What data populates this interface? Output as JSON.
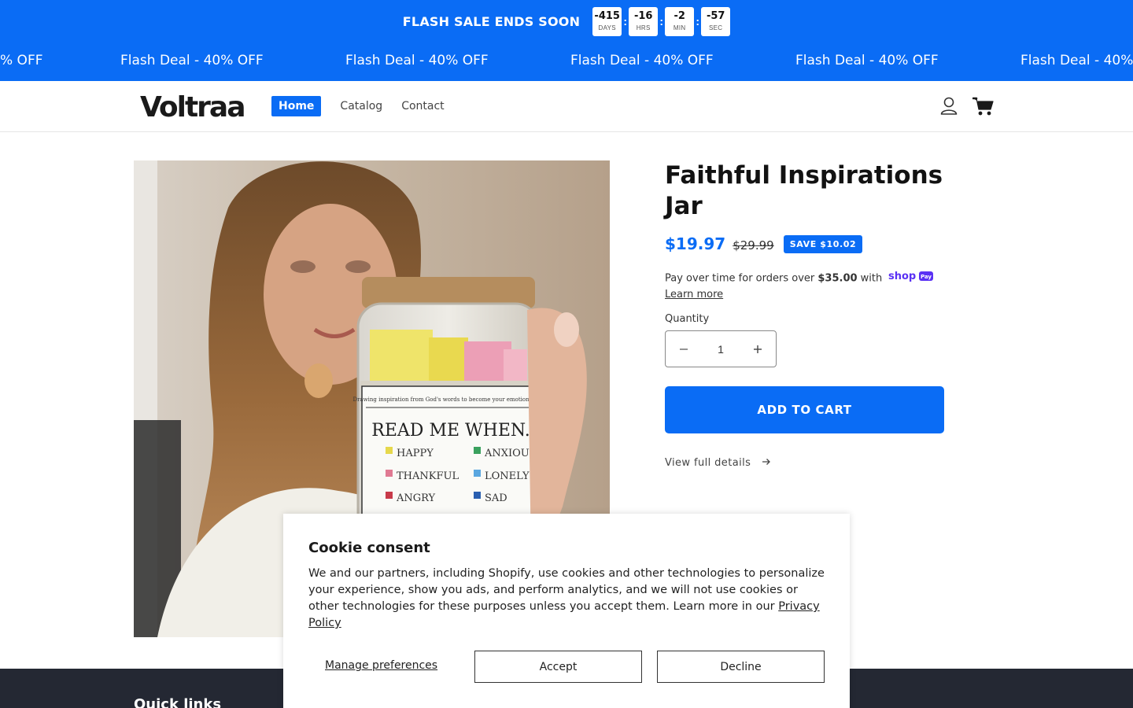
{
  "announcement": {
    "title": "FLASH SALE ENDS SOON",
    "countdown": [
      {
        "value": "-415",
        "unit": "DAYS"
      },
      {
        "value": "-16",
        "unit": "HRS"
      },
      {
        "value": "-2",
        "unit": "MIN"
      },
      {
        "value": "-57",
        "unit": "SEC"
      }
    ],
    "separator": ":"
  },
  "marquee": {
    "text_partial": "% OFF",
    "text": "Flash Deal - 40% OFF",
    "text_cut": "Flash Deal - 40%"
  },
  "header": {
    "logo": "Voltraa",
    "nav": [
      "Home",
      "Catalog",
      "Contact"
    ]
  },
  "product": {
    "title": "Faithful Inspirations Jar",
    "price": "$19.97",
    "compare_price": "$29.99",
    "save_badge": "SAVE $10.02",
    "installments": {
      "prefix": "Pay over time for orders over ",
      "amount": "$35.00",
      "suffix": " with",
      "provider": "shop",
      "provider_pay": "Pay",
      "link": "Learn more"
    },
    "quantity_label": "Quantity",
    "quantity_value": "1",
    "add_to_cart": "ADD TO CART",
    "view_details": "View full details",
    "jar_label": {
      "caption": "Drawing inspiration from God's words to become your emotional strength",
      "heading": "READ ME WHEN...",
      "left": [
        "HAPPY",
        "THANKFUL",
        "ANGRY"
      ],
      "right": [
        "ANXIOUS",
        "LONELY",
        "SAD"
      ]
    }
  },
  "footer": {
    "heading": "Quick links"
  },
  "cookie": {
    "title": "Cookie consent",
    "body": "We and our partners, including Shopify, use cookies and other technologies to personalize your experience, show you ads, and perform analytics, and we will not use cookies or other technologies for these purposes unless you accept them. Learn more in our ",
    "link": "Privacy Policy",
    "manage": "Manage preferences",
    "accept": "Accept",
    "decline": "Decline"
  },
  "colors": {
    "accent": "#0a6cf5",
    "footer": "#242833",
    "text": "#121212"
  }
}
